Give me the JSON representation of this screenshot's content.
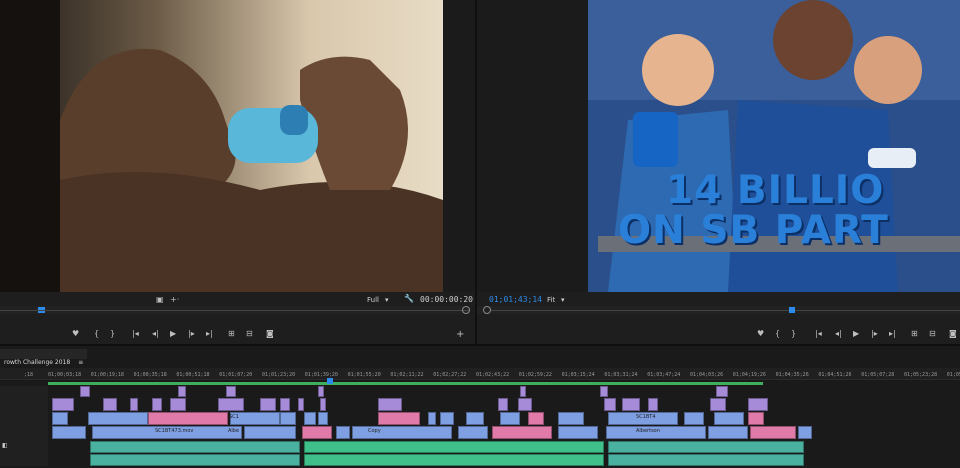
{
  "source": {
    "zoom": "Full",
    "timecode": "00:00:00:20"
  },
  "program": {
    "timecode": "01;01;43;14",
    "zoom": "Fit",
    "overlay_line1": "14 BILLIO",
    "overlay_line2": "ON SB PART"
  },
  "timeline": {
    "sequence_tab": "rowth Challenge 2018",
    "playhead_start": ";18",
    "ticks": [
      "01;00;03;18",
      "01;00;19;18",
      "01;00;35;18",
      "01;00;51;18",
      "01;01;07;20",
      "01;01;23;20",
      "01;01;39;20",
      "01;01;55;20",
      "01;02;11;22",
      "01;02;27;22",
      "01;02;43;22",
      "01;02;59;22",
      "01;03;15;24",
      "01;03;31;24",
      "01;03;47;24",
      "01;04;03;26",
      "01;04;19;26",
      "01;04;35;26",
      "01;04;51;26",
      "01;05;07;28",
      "01;05;23;28",
      "01;05;3"
    ],
    "clip_labels": {
      "sc1": "SC1",
      "sc1bt473": "SC1BT473.mov",
      "albe": "Albe",
      "copy": "Copy",
      "sc1bt4b": "SC1BT4",
      "albertson": "Albertson"
    }
  },
  "colors": {
    "accent_blue": "#2d8ceb",
    "clip_violet": "#a58bd8",
    "clip_blue": "#7f9fe3",
    "clip_pink": "#e07aa8",
    "clip_green": "#3fbf8a",
    "clip_teal": "#4ab0a0"
  }
}
